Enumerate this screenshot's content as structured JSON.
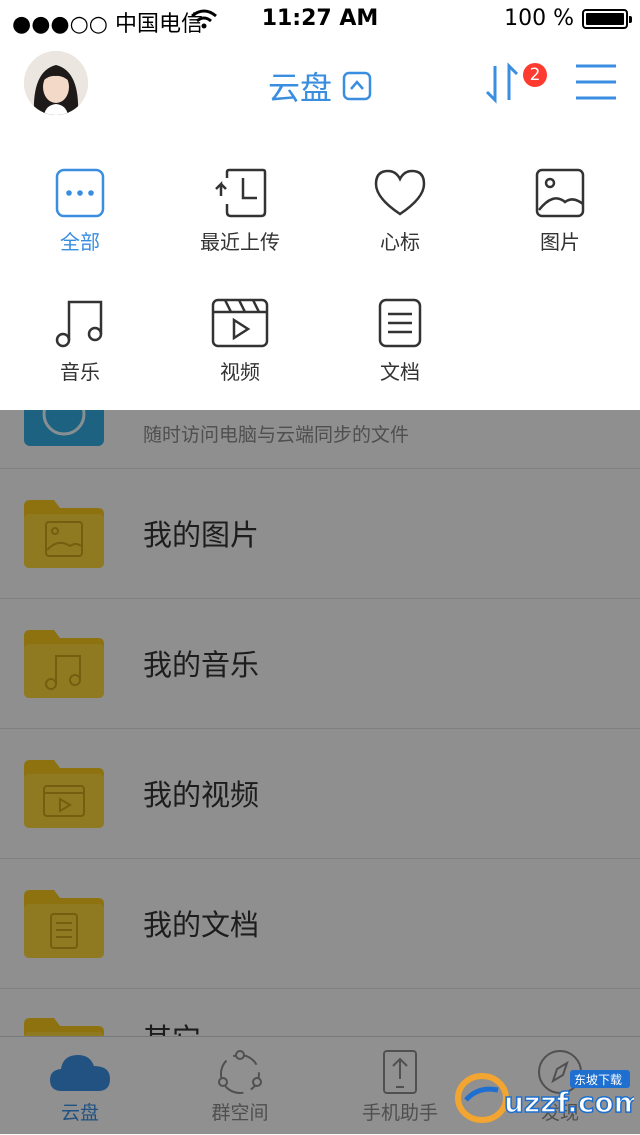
{
  "status_bar": {
    "carrier": "●●●○○ 中国电信",
    "time": "11:27 AM",
    "battery": "100 %"
  },
  "header": {
    "title": "云盘",
    "badge_count": "2"
  },
  "categories": [
    {
      "label": "全部",
      "icon": "more-dots-icon",
      "active": true
    },
    {
      "label": "最近上传",
      "icon": "recent-upload-icon"
    },
    {
      "label": "心标",
      "icon": "heart-icon"
    },
    {
      "label": "图片",
      "icon": "image-icon"
    },
    {
      "label": "音乐",
      "icon": "music-icon"
    },
    {
      "label": "视频",
      "icon": "video-icon"
    },
    {
      "label": "文档",
      "icon": "document-icon"
    }
  ],
  "list": {
    "sync_subtitle": "随时访问电脑与云端同步的文件",
    "folders": [
      {
        "name": "我的图片",
        "icon": "image-icon"
      },
      {
        "name": "我的音乐",
        "icon": "music-icon"
      },
      {
        "name": "我的视频",
        "icon": "video-icon"
      },
      {
        "name": "我的文档",
        "icon": "document-icon"
      },
      {
        "name": "其它",
        "icon": "folder-icon"
      }
    ]
  },
  "tabbar": [
    {
      "label": "云盘",
      "icon": "cloud-icon",
      "active": true
    },
    {
      "label": "群空间",
      "icon": "group-space-icon"
    },
    {
      "label": "手机助手",
      "icon": "phone-assistant-icon"
    },
    {
      "label": "发现",
      "icon": "compass-icon"
    }
  ],
  "watermark": {
    "text": "uzzf.com",
    "subtext": "东坡下载"
  },
  "colors": {
    "accent": "#3a8ee0",
    "folder": "#f5c51c",
    "badge": "#ff3b30",
    "sync_tile": "#33a9dd"
  }
}
